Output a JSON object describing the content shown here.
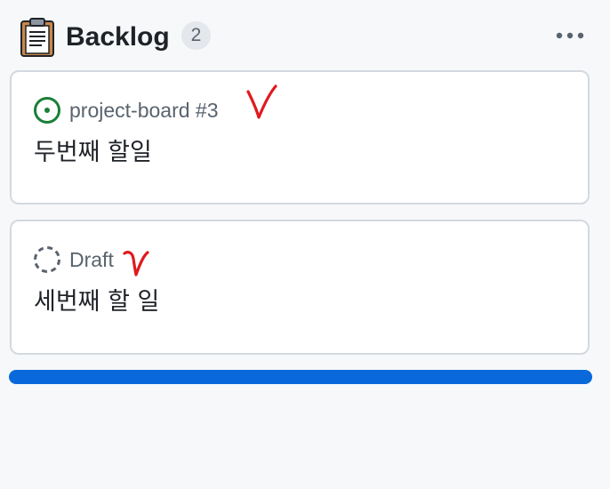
{
  "column": {
    "icon": "clipboard-icon",
    "title": "Backlog",
    "count": "2",
    "menu_icon": "kebab-horizontal-icon"
  },
  "cards": [
    {
      "status_icon": "issue-open-icon",
      "status_color": "#1a7f37",
      "reference": "project-board #3",
      "title": "두번째 할일"
    },
    {
      "status_icon": "issue-draft-icon",
      "status_color": "#59636e",
      "reference": "Draft",
      "title": "세번째 할 일"
    }
  ],
  "annotations": {
    "mark_icon": "handwritten-check-icon",
    "mark_color": "#e0191e"
  },
  "colors": {
    "background": "#f6f8fa",
    "card_border": "#d4d9df",
    "accent_bar": "#0969da"
  }
}
